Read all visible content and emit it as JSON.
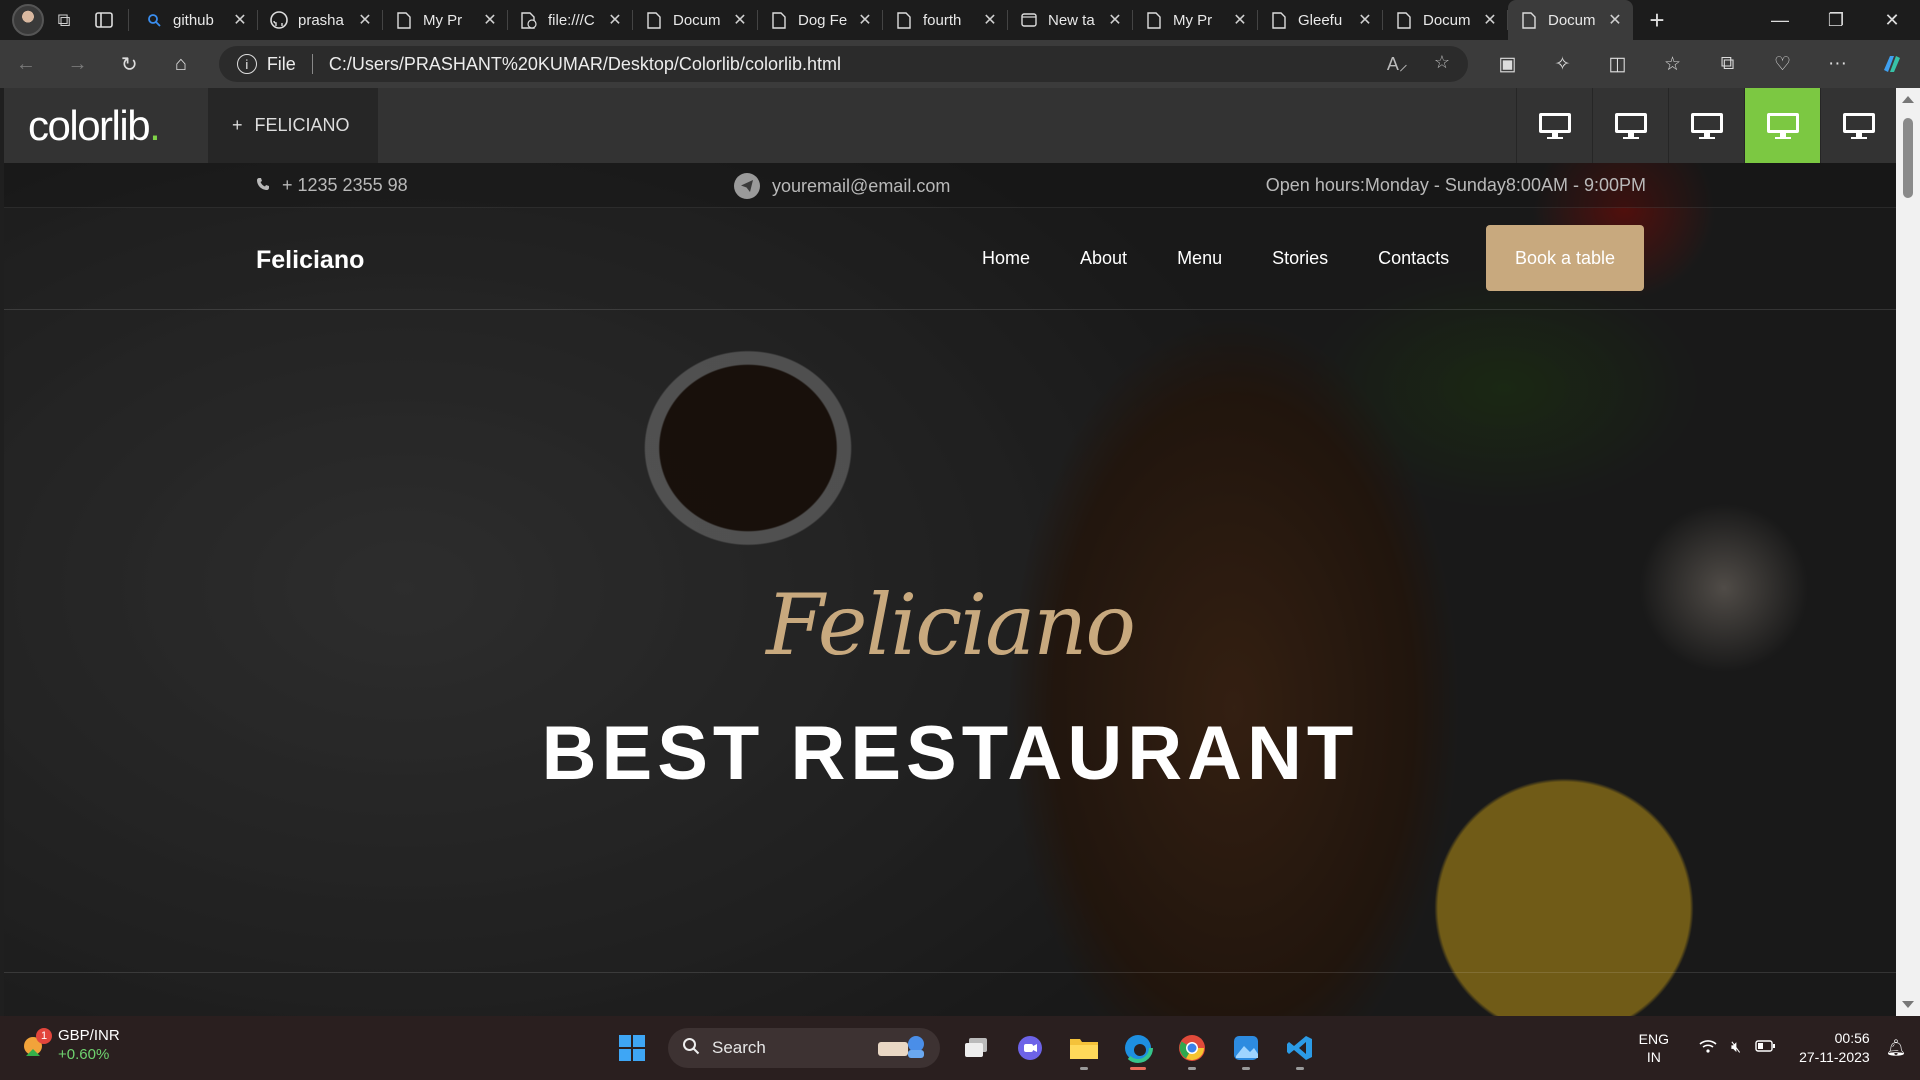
{
  "browser": {
    "tabs": [
      {
        "title": "github",
        "icon": "search-icon",
        "active": false
      },
      {
        "title": "prasha",
        "icon": "github-icon",
        "active": false
      },
      {
        "title": "My Pr",
        "icon": "page-icon",
        "active": false
      },
      {
        "title": "file:///C",
        "icon": "file-icon",
        "active": false
      },
      {
        "title": "Docum",
        "icon": "page-icon",
        "active": false
      },
      {
        "title": "Dog Fe",
        "icon": "page-icon",
        "active": false
      },
      {
        "title": "fourth",
        "icon": "page-icon",
        "active": false
      },
      {
        "title": "New ta",
        "icon": "new-tab-icon",
        "active": false
      },
      {
        "title": "My Pr",
        "icon": "page-icon",
        "active": false
      },
      {
        "title": "Gleefu",
        "icon": "page-icon",
        "active": false
      },
      {
        "title": "Docum",
        "icon": "page-icon",
        "active": false
      },
      {
        "title": "Docum",
        "icon": "page-icon",
        "active": true
      }
    ],
    "address": {
      "scheme_label": "File",
      "url": "C:/Users/PRASHANT%20KUMAR/Desktop/Colorlib/colorlib.html"
    }
  },
  "demo_bar": {
    "logo_text": "colorlib",
    "logo_dot": ".",
    "site_plus": "+",
    "site_name": "FELICIANO",
    "active_device_index": 3,
    "active_color": "#7cc842"
  },
  "infobar": {
    "phone": "+ 1235 2355 98",
    "email": "youremail@email.com",
    "hours": "Open hours:Monday - Sunday8:00AM - 9:00PM"
  },
  "site": {
    "brand": "Feliciano",
    "menu": [
      "Home",
      "About",
      "Menu",
      "Stories",
      "Contacts"
    ],
    "cta": "Book a table",
    "accent": "#c8a97e"
  },
  "hero": {
    "script_title": "Feliciano",
    "headline": "BEST RESTAURANT"
  },
  "taskbar": {
    "widget_badge": "1",
    "widget_title": "GBP/INR",
    "widget_change": "+0.60%",
    "search_label": "Search",
    "lang_line1": "ENG",
    "lang_line2": "IN",
    "time": "00:56",
    "date": "27-11-2023"
  }
}
